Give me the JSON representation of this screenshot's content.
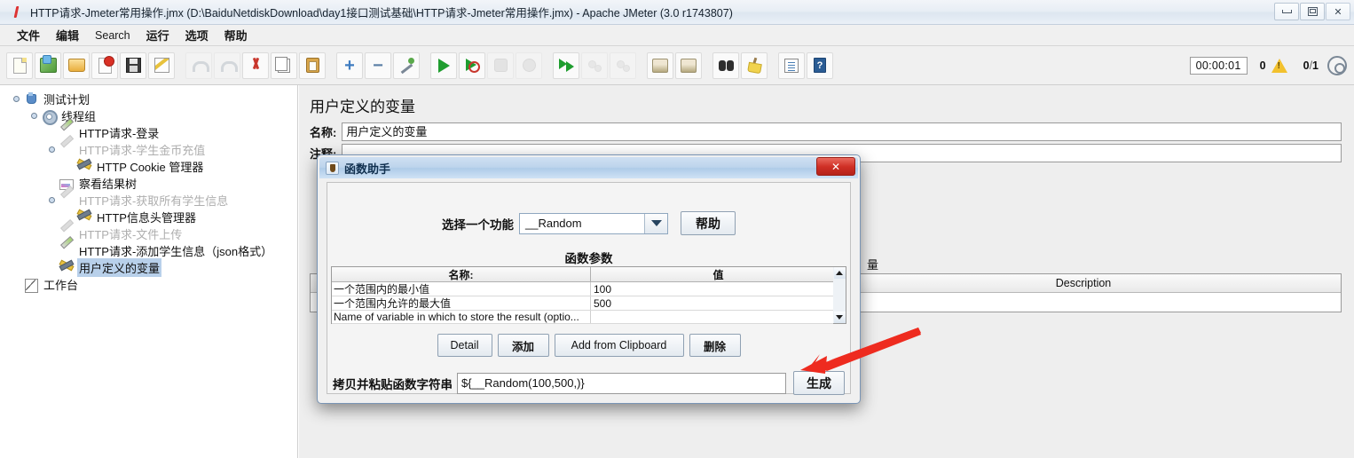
{
  "window": {
    "title": "HTTP请求-Jmeter常用操作.jmx (D:\\BaiduNetdiskDownload\\day1接口测试基础\\HTTP请求-Jmeter常用操作.jmx) - Apache JMeter (3.0 r1743807)",
    "app_icon": "jmeter-feather-icon",
    "controls": {
      "minimize": "minimize-icon",
      "restore": "restore-icon",
      "close": "✕"
    }
  },
  "menubar": {
    "items": [
      {
        "label": "文件",
        "latin": false
      },
      {
        "label": "编辑",
        "latin": false
      },
      {
        "label": "Search",
        "latin": true
      },
      {
        "label": "运行",
        "latin": false
      },
      {
        "label": "选项",
        "latin": false
      },
      {
        "label": "帮助",
        "latin": false
      }
    ]
  },
  "toolbar": {
    "buttons": [
      {
        "name": "new-button",
        "icon": "new-page-icon",
        "disabled": false
      },
      {
        "name": "templates-button",
        "icon": "templates-icon",
        "disabled": false
      },
      {
        "name": "open-button",
        "icon": "open-folder-icon",
        "disabled": false
      },
      {
        "name": "close-button",
        "icon": "close-document-icon",
        "disabled": false
      },
      {
        "name": "save-button",
        "icon": "save-disk-icon",
        "disabled": false
      },
      {
        "name": "save-as-button",
        "icon": "save-as-icon",
        "disabled": false
      },
      {
        "name": "undo-button",
        "icon": "undo-arrow-icon",
        "disabled": true
      },
      {
        "name": "redo-button",
        "icon": "redo-arrow-icon",
        "disabled": true
      },
      {
        "name": "cut-button",
        "icon": "scissors-icon",
        "disabled": false
      },
      {
        "name": "copy-button",
        "icon": "copy-icon",
        "disabled": false
      },
      {
        "name": "paste-button",
        "icon": "clipboard-paste-icon",
        "disabled": false
      },
      {
        "name": "expand-all-button",
        "icon": "plus-icon",
        "disabled": false
      },
      {
        "name": "collapse-all-button",
        "icon": "minus-icon",
        "disabled": false
      },
      {
        "name": "toggle-button",
        "icon": "wand-toggle-icon",
        "disabled": false
      },
      {
        "name": "start-button",
        "icon": "play-icon",
        "disabled": false
      },
      {
        "name": "start-no-pauses-button",
        "icon": "play-no-pauses-icon",
        "disabled": false
      },
      {
        "name": "stop-button",
        "icon": "stop-icon",
        "disabled": true
      },
      {
        "name": "shutdown-button",
        "icon": "shutdown-icon",
        "disabled": true
      },
      {
        "name": "remote-start-all-button",
        "icon": "remote-start-icon",
        "disabled": false
      },
      {
        "name": "remote-stop-all-button",
        "icon": "remote-stop-icon",
        "disabled": true
      },
      {
        "name": "remote-shutdown-all-button",
        "icon": "remote-shutdown-icon",
        "disabled": true
      },
      {
        "name": "clear-button",
        "icon": "clear-brush-icon",
        "disabled": false
      },
      {
        "name": "clear-all-button",
        "icon": "clear-all-brush-icon",
        "disabled": false
      },
      {
        "name": "search-button",
        "icon": "binoculars-icon",
        "disabled": false
      },
      {
        "name": "reset-search-button",
        "icon": "broom-icon",
        "disabled": false
      },
      {
        "name": "function-helper-button",
        "icon": "function-helper-list-icon",
        "disabled": false
      },
      {
        "name": "help-button",
        "icon": "help-book-icon",
        "disabled": false
      }
    ],
    "status": {
      "elapsed": "00:00:01",
      "warning_count": "0",
      "warning_icon": "warning-triangle-icon",
      "threads_active": "0",
      "threads_separator": "/",
      "threads_total": "1",
      "error_icon": "error-indicator-icon"
    }
  },
  "tree": {
    "nodes": [
      {
        "label": "测试计划",
        "icon": "test-plan-icon",
        "depth": 0,
        "disabled": false,
        "selected": false,
        "expander": true
      },
      {
        "label": "线程组",
        "icon": "thread-group-icon",
        "depth": 1,
        "disabled": false,
        "selected": false,
        "expander": true
      },
      {
        "label": "HTTP请求-登录",
        "icon": "http-request-icon",
        "depth": 2,
        "disabled": false,
        "selected": false,
        "expander": false
      },
      {
        "label": "HTTP请求-学生金币充值",
        "icon": "http-request-icon",
        "depth": 2,
        "disabled": true,
        "selected": false,
        "expander": true
      },
      {
        "label": "HTTP Cookie 管理器",
        "icon": "config-tools-icon",
        "depth": 3,
        "disabled": false,
        "selected": false,
        "expander": false
      },
      {
        "label": "察看结果树",
        "icon": "view-results-icon",
        "depth": 2,
        "disabled": false,
        "selected": false,
        "expander": false
      },
      {
        "label": "HTTP请求-获取所有学生信息",
        "icon": "http-request-icon",
        "depth": 2,
        "disabled": true,
        "selected": false,
        "expander": true
      },
      {
        "label": "HTTP信息头管理器",
        "icon": "config-tools-icon",
        "depth": 3,
        "disabled": false,
        "selected": false,
        "expander": false
      },
      {
        "label": "HTTP请求-文件上传",
        "icon": "http-request-icon",
        "depth": 2,
        "disabled": true,
        "selected": false,
        "expander": false
      },
      {
        "label": "HTTP请求-添加学生信息（json格式）",
        "icon": "http-request-icon",
        "depth": 2,
        "disabled": false,
        "selected": false,
        "expander": false
      },
      {
        "label": "用户定义的变量",
        "icon": "config-tools-icon",
        "depth": 2,
        "disabled": false,
        "selected": true,
        "expander": false
      },
      {
        "label": "工作台",
        "icon": "workbench-icon",
        "depth": 0,
        "disabled": false,
        "selected": false,
        "expander": false
      }
    ]
  },
  "right_panel": {
    "title": "用户定义的变量",
    "name_label": "名称:",
    "name_value": "用户定义的变量",
    "comment_label": "注释:",
    "comment_value": "",
    "section_label": "量",
    "table": {
      "headers": [
        "",
        "Description"
      ],
      "rows": [
        [
          "",
          ""
        ]
      ]
    }
  },
  "dialog": {
    "title": "函数助手",
    "icon": "java-coffee-icon",
    "close_label": "✕",
    "select_function_label": "选择一个功能",
    "selected_function": "__Random",
    "help_button": "帮助",
    "params_section_label": "函数参数",
    "params_table": {
      "headers": [
        "名称:",
        "值"
      ],
      "rows": [
        {
          "name": "一个范围内的最小值",
          "value": "100"
        },
        {
          "name": "一个范围内允许的最大值",
          "value": "500"
        },
        {
          "name": "Name of variable in which to store the result (optio...",
          "value": ""
        }
      ]
    },
    "scrollbar": {
      "up_icon": "scroll-up-arrow-icon",
      "down_icon": "scroll-down-arrow-icon"
    },
    "buttons": [
      {
        "name": "detail-button",
        "label": "Detail"
      },
      {
        "name": "add-button",
        "label": "添加"
      },
      {
        "name": "add-from-clipboard-button",
        "label": "Add from Clipboard"
      },
      {
        "name": "delete-button",
        "label": "删除"
      }
    ],
    "result_label": "拷贝并粘贴函数字符串",
    "result_value": "${__Random(100,500,)}",
    "generate_button": "生成"
  },
  "annotation": {
    "arrow_color": "#ee2b1f",
    "arrow_name": "red-pointer-arrow"
  },
  "colors": {
    "selection_blue": "#b8d0ea",
    "dialog_title_blue": "#bdd4ec",
    "close_red": "#cf2f25",
    "warning_yellow": "#f2c12e"
  }
}
